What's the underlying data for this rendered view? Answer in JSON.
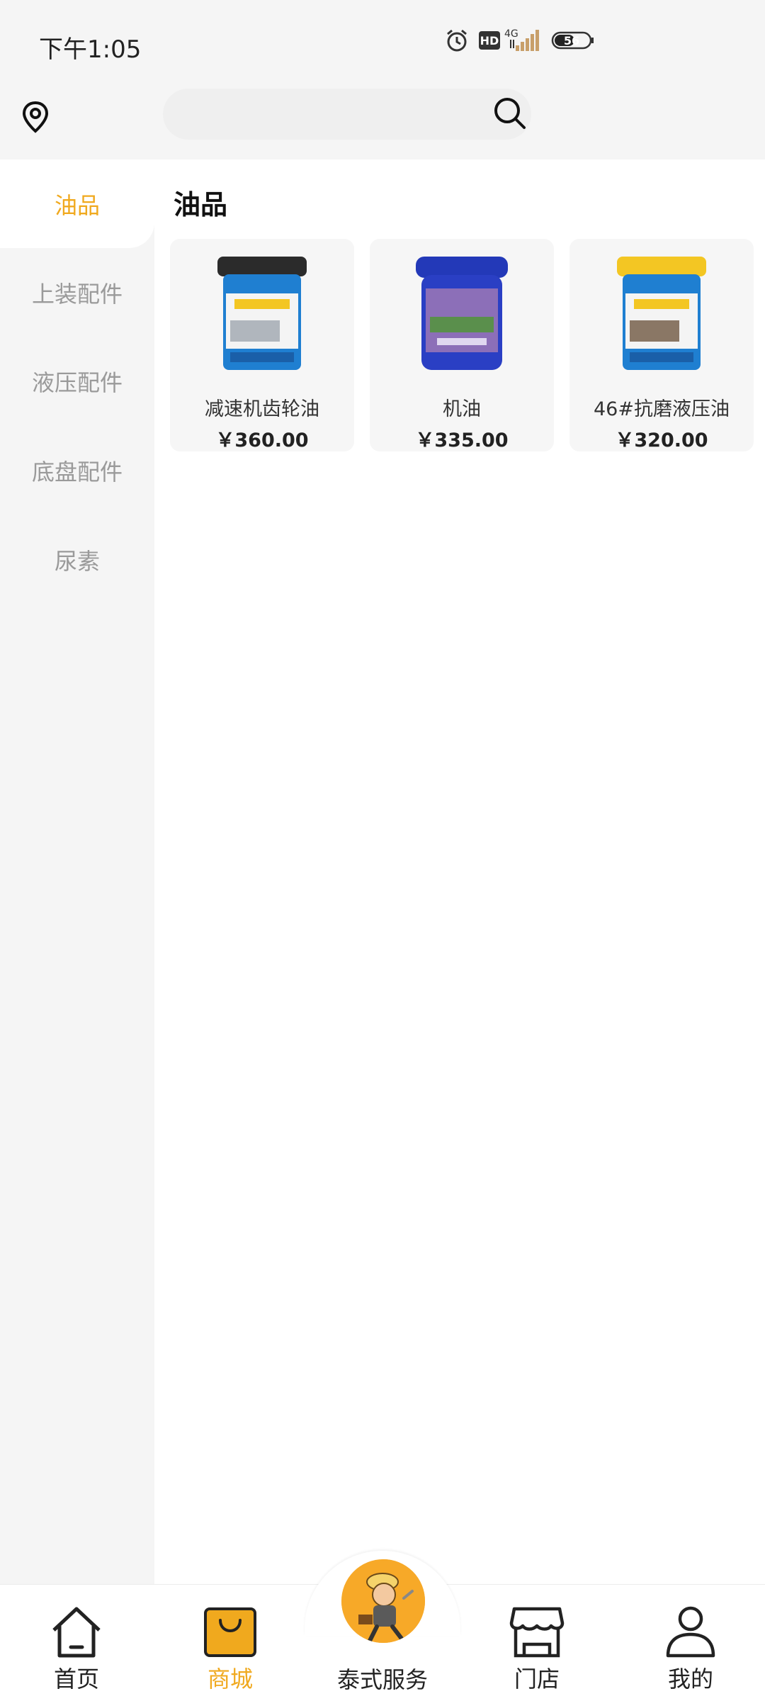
{
  "status_bar": {
    "time": "下午1:05",
    "network": "4G",
    "battery": "56",
    "icons": [
      "alarm-icon",
      "hd-icon",
      "signal-icon",
      "battery-icon"
    ]
  },
  "header": {
    "icons": [
      "location-icon",
      "search-icon"
    ]
  },
  "sidebar": {
    "items": [
      {
        "label": "油品",
        "active": true
      },
      {
        "label": "上装配件",
        "active": false
      },
      {
        "label": "液压配件",
        "active": false
      },
      {
        "label": "底盘配件",
        "active": false
      },
      {
        "label": "尿素",
        "active": false
      }
    ]
  },
  "main": {
    "section_title": "油品",
    "products": [
      {
        "name": "减速机齿轮油",
        "price": "￥360.00"
      },
      {
        "name": "机油",
        "price": "￥335.00"
      },
      {
        "name": "46#抗磨液压油",
        "price": "￥320.00"
      }
    ]
  },
  "bottom_nav": {
    "items": [
      {
        "label": "首页",
        "icon": "home-icon",
        "active": false
      },
      {
        "label": "商城",
        "icon": "shopping-bag-icon",
        "active": true
      },
      {
        "label": "泰式服务",
        "icon": "mascot-avatar",
        "active": false
      },
      {
        "label": "门店",
        "icon": "store-icon",
        "active": false
      },
      {
        "label": "我的",
        "icon": "profile-icon",
        "active": false
      }
    ]
  },
  "colors": {
    "accent": "#f0a91e",
    "background": "#f5f5f5",
    "inactive_text": "#9a9a9a"
  }
}
